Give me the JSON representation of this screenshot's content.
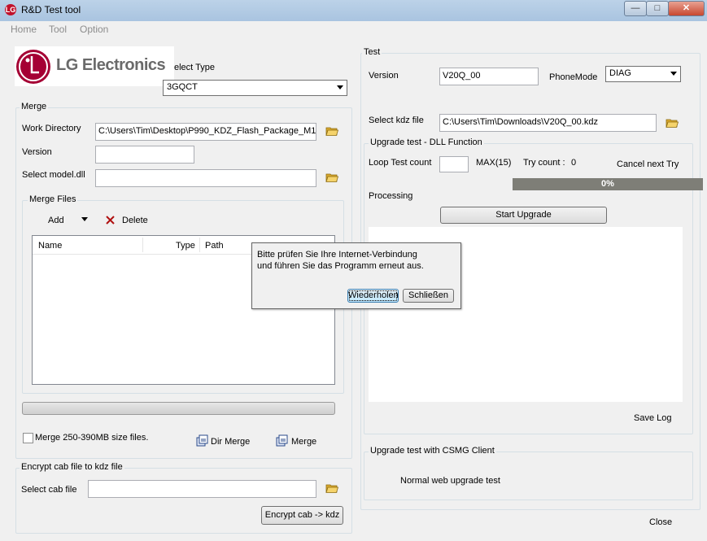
{
  "window": {
    "title": "R&D Test tool",
    "app_icon_text": "LG"
  },
  "menu": {
    "items": [
      "Home",
      "Tool",
      "Option"
    ]
  },
  "logo": {
    "text": "LG Electronics"
  },
  "left": {
    "select_type_label": "elect Type",
    "select_type_value": "3GQCT",
    "merge": {
      "title": "Merge",
      "work_dir_label": "Work Directory",
      "work_dir_value": "C:\\Users\\Tim\\Desktop\\P990_KDZ_Flash_Package_M1",
      "version_label": "Version",
      "version_value": "",
      "model_dll_label": "Select model.dll",
      "model_dll_value": "",
      "files": {
        "title": "Merge Files",
        "add_label": "Add",
        "delete_label": "Delete",
        "columns": {
          "name": "Name",
          "type": "Type",
          "path": "Path"
        }
      },
      "checkbox_label": "Merge 250-390MB size files.",
      "dir_merge_label": "Dir Merge",
      "merge_label": "Merge"
    },
    "encrypt": {
      "title": "Encrypt cab file to kdz file",
      "cab_label": "Select cab file",
      "cab_value": "",
      "button_label": "Encrypt cab -> kdz"
    }
  },
  "test": {
    "title": "Test",
    "version_label": "Version",
    "version_value": "V20Q_00",
    "phone_mode_label": "PhoneMode",
    "phone_mode_value": "DIAG",
    "kdz_label": "Select kdz file",
    "kdz_value": "C:\\Users\\Tim\\Downloads\\V20Q_00.kdz",
    "dll": {
      "title": "Upgrade test - DLL Function",
      "loop_label": "Loop Test count",
      "loop_value": "",
      "max_label": "MAX(15)",
      "try_count_label": "Try count :",
      "try_count_value": "0",
      "cancel_label": "Cancel next Try",
      "progress_text": "0%",
      "progress_value": 0,
      "processing_label": "Processing",
      "start_button": "Start Upgrade",
      "save_log": "Save Log"
    },
    "csmg": {
      "title": "Upgrade test with CSMG Client",
      "normal_label": "Normal web upgrade test"
    },
    "close_label": "Close"
  },
  "dialog": {
    "line1": "Bitte prüfen Sie Ihre Internet-Verbindung",
    "line2": "und führen Sie das Programm erneut aus.",
    "retry_button": "Wiederholen",
    "close_button": "Schließen"
  }
}
